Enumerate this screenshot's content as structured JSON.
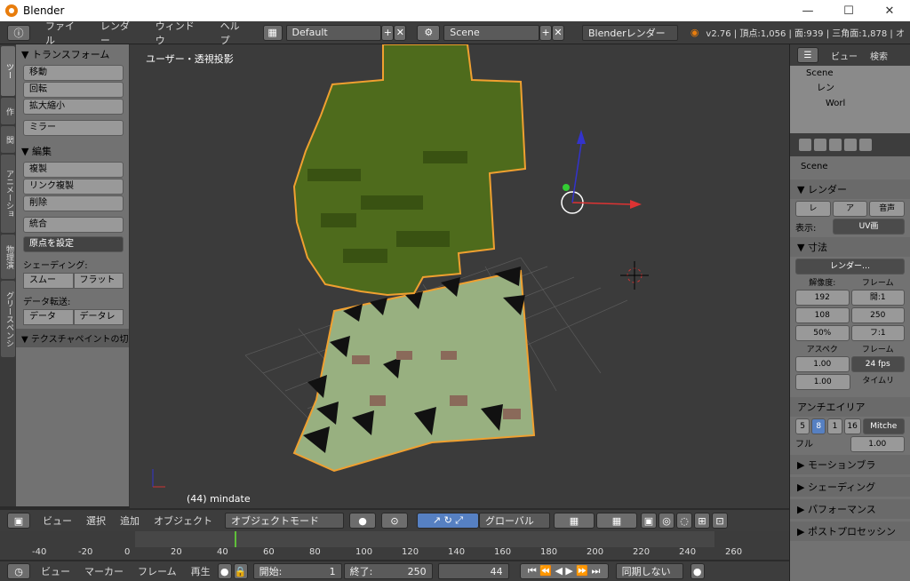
{
  "window": {
    "title": "Blender",
    "controls": [
      "—",
      "☐",
      "✕"
    ]
  },
  "menubar": {
    "items": [
      "ファイル",
      "レンダー",
      "ウィンドウ",
      "ヘルプ"
    ],
    "screen": "Default",
    "scene": "Scene",
    "engine": "Blenderレンダー",
    "stats": "v2.76 | 頂点:1,056 | 面:939 | 三角面:1,878 | オ"
  },
  "tabs": [
    "ツー",
    "作",
    "関",
    "アニメーショ",
    "物理演",
    "グリースペンシ"
  ],
  "toolshelf": {
    "transform_header": "▼ トランスフォーム",
    "transform": [
      "移動",
      "回転",
      "拡大縮小"
    ],
    "mirror": "ミラー",
    "edit_header": "▼ 編集",
    "edit": [
      "複製",
      "リンク複製",
      "削除"
    ],
    "join": "統合",
    "origin": "原点を設定",
    "shading_label": "シェーディング:",
    "shading": [
      "スムー",
      "フラット"
    ],
    "transfer_label": "データ転送:",
    "transfer": [
      "データ",
      "データレ"
    ],
    "texpaint": "▼ テクスチャペイントの切"
  },
  "viewport": {
    "label": "ユーザー・透視投影",
    "object": "(44) mindate"
  },
  "outliner": {
    "menu": [
      "ビュー",
      "検索"
    ],
    "items": [
      "Scene",
      "レン",
      "Worl"
    ]
  },
  "properties": {
    "scene": "Scene",
    "render_header": "▼ レンダー",
    "render_btns": [
      "レ",
      "ア",
      "音声"
    ],
    "display_label": "表示:",
    "display_value": "UV画",
    "dims_header": "▼ 寸法",
    "preset": "レンダー…",
    "res_label": "解像度:",
    "frame_label": "フレーム",
    "res_x": "192",
    "res_y": "108",
    "res_pct": "50%",
    "frame_start": "開:1",
    "frame_end": "250",
    "frame_step": "フ:1",
    "aspect_label": "アスペク",
    "frame2_label": "フレーム",
    "aspect_x": "1.00",
    "aspect_y": "1.00",
    "fps": "24 fps",
    "time_label": "タイムリ",
    "aa_header": "アンチエイリア",
    "aa_samples": [
      "5",
      "8",
      "1",
      "16"
    ],
    "aa_filter": "Mitche",
    "full": "フル",
    "filter_size": "1.00",
    "motion": "▶ モーションブラ",
    "shading": "▶ シェーディング",
    "perf": "▶ パフォーマンス",
    "post": "▶ ポストプロセッシン"
  },
  "vpheader": {
    "items": [
      "ビュー",
      "選択",
      "追加",
      "オブジェクト"
    ],
    "mode": "オブジェクトモード",
    "orient": "グローバル"
  },
  "ruler": {
    "ticks": [
      "-40",
      "-20",
      "0",
      "20",
      "40",
      "60",
      "80",
      "100",
      "120",
      "140",
      "160",
      "180",
      "200",
      "220",
      "240",
      "260"
    ]
  },
  "timeline": {
    "items": [
      "ビュー",
      "マーカー",
      "フレーム",
      "再生"
    ],
    "start": "開始:",
    "start_val": "1",
    "end": "終了:",
    "end_val": "250",
    "current": "44",
    "sync": "同期しない"
  },
  "colors": {
    "bg": "#3b3b3b",
    "panel": "#727272",
    "header": "#3d3d3d",
    "accent": "#5680c2",
    "select": "#f0a030",
    "tree": "#4a6a1a",
    "ground": "#98b080"
  }
}
